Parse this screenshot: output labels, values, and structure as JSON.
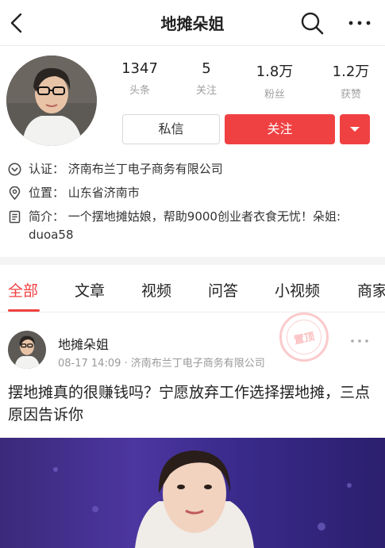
{
  "header": {
    "title": "地摊朵姐",
    "back_icon": "back-arrow-icon",
    "search_icon": "search-icon",
    "more_icon": "more-dots-icon"
  },
  "profile": {
    "stats": [
      {
        "value": "1347",
        "label": "头条"
      },
      {
        "value": "5",
        "label": "关注"
      },
      {
        "value": "1.8万",
        "label": "粉丝"
      },
      {
        "value": "1.2万",
        "label": "获赞"
      }
    ],
    "message_label": "私信",
    "follow_label": "关注",
    "accent_color": "#f04142",
    "info": [
      {
        "icon": "verified-icon",
        "text": "认证：  济南布兰丁电子商务有限公司"
      },
      {
        "icon": "location-icon",
        "text": "位置：  山东省济南市"
      },
      {
        "icon": "document-icon",
        "text": "简介：  一个摆地摊姑娘，帮助9000创业者衣食无忧！朵姐: duoa58"
      }
    ]
  },
  "tabs": [
    "全部",
    "文章",
    "视频",
    "问答",
    "小视频",
    "商家"
  ],
  "post": {
    "author": "地摊朵姐",
    "meta": "08-17 14:09 · 济南布兰丁电子商务有限公司",
    "stamp": "置顶",
    "title": "摆地摊真的很赚钱吗？宁愿放弃工作选择摆地摊，三点原因告诉你"
  }
}
